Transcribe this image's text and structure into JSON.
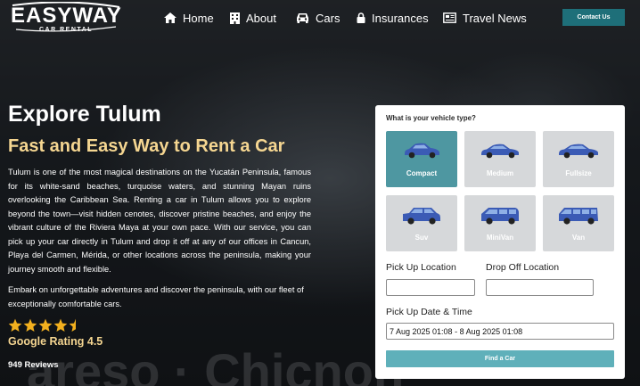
{
  "brand": {
    "name": "EASYWAY",
    "tagline": "CAR RENTAL"
  },
  "nav": {
    "items": [
      {
        "label": "Home",
        "icon": "home-icon"
      },
      {
        "label": "About",
        "icon": "building-icon"
      },
      {
        "label": "Cars",
        "icon": "car-icon"
      },
      {
        "label": "Insurances",
        "icon": "lock-icon"
      },
      {
        "label": "Travel News",
        "icon": "newspaper-icon"
      }
    ],
    "contact_label": "Contact Us"
  },
  "hero": {
    "title": "Explore Tulum",
    "subtitle": "Fast and Easy Way to Rent a Car",
    "paragraph1": "Tulum is one of the most magical destinations on the Yucatán Peninsula, famous for its white-sand beaches, turquoise waters, and stunning Mayan ruins overlooking the Caribbean Sea. Renting a car in Tulum allows you to explore beyond the town—visit hidden cenotes, discover pristine beaches, and enjoy the vibrant culture of the Riviera Maya at your own pace. With our service, you can pick up your car directly in Tulum and drop it off at any of our offices in Cancun, Playa del Carmen, Mérida, or other locations across the peninsula, making your journey smooth and flexible.",
    "paragraph2": "Embark on unforgettable adventures and discover the peninsula, with our fleet of exceptionally comfortable cars.",
    "rating_value": 4.5,
    "rating_label": "Google Rating 4.5",
    "reviews_label": "949 Reviews",
    "watermark": "areso · Chicnon"
  },
  "form": {
    "question": "What is your vehicle type?",
    "vehicles": [
      {
        "label": "Compact",
        "selected": true
      },
      {
        "label": "Medium",
        "selected": false
      },
      {
        "label": "Fullsize",
        "selected": false
      },
      {
        "label": "Suv",
        "selected": false
      },
      {
        "label": "MiniVan",
        "selected": false
      },
      {
        "label": "Van",
        "selected": false
      }
    ],
    "pickup_label": "Pick Up Location",
    "pickup_value": "",
    "dropoff_label": "Drop Off Location",
    "dropoff_value": "",
    "dates_label": "Pick Up Date & Time",
    "dates_value": "7 Aug 2025 01:08 - 8 Aug 2025 01:08",
    "submit_label": "Find a Car"
  },
  "colors": {
    "accent": "#1e6f79",
    "selected_tile": "#4e97a1",
    "button": "#5fb0ba",
    "gold": "#f5d691",
    "star": "#f2b01e",
    "car_blue": "#3b5bb5"
  }
}
